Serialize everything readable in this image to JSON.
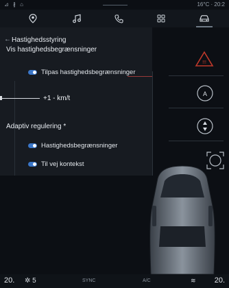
{
  "status_bar": {
    "left_icons": "⊿ ∦ ⌂",
    "right_text": "16°C · 20:2"
  },
  "nav": {
    "items": [
      {
        "name": "location-icon"
      },
      {
        "name": "music-icon"
      },
      {
        "name": "phone-icon"
      },
      {
        "name": "apps-icon"
      },
      {
        "name": "car-icon",
        "active": true
      }
    ]
  },
  "panel": {
    "back_arrow": "←",
    "title": "Hastighedsstyring",
    "subtitle": "Vis hastighedsbegrænsninger",
    "toggle_adjust_label": "Tilpas hastighedsbegrænsninger",
    "offset_value": "+1 - km/t",
    "adaptive_title": "Adaptiv regulering *",
    "toggle_speed_limits_label": "Hastighedsbegrænsninger",
    "toggle_road_context_label": "Til vej kontekst"
  },
  "right_panel": {
    "warning_text": "!!!",
    "speed_icon_text": "A"
  },
  "bottom_bar": {
    "temp_left": "20.",
    "fan_level": "5",
    "sync_label": "SYNC",
    "ac_label": "A/C",
    "temp_right": "20."
  },
  "colors": {
    "toggle_on": "#3a76c8",
    "accent_red": "#c0392b",
    "panel_bg": "#171b21"
  }
}
